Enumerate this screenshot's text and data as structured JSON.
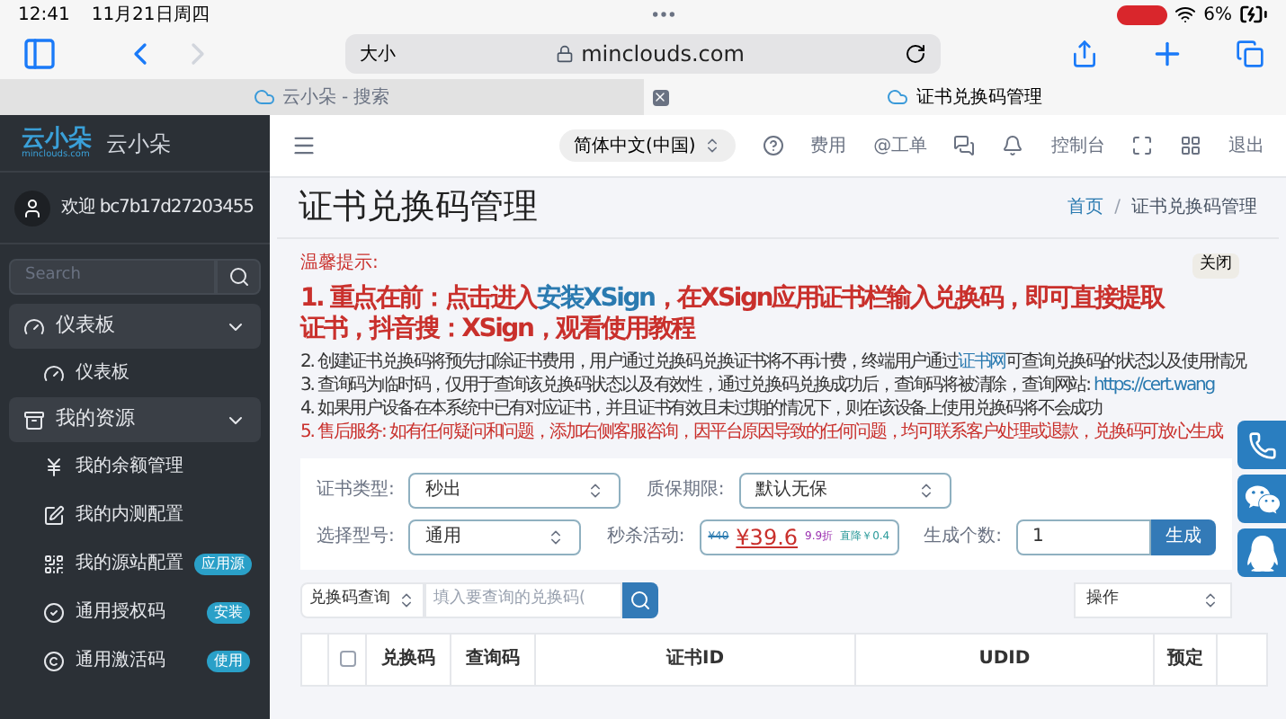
{
  "status_bar": {
    "time": "12:41",
    "date": "11月21日周四",
    "battery": "6%"
  },
  "browser": {
    "text_size": "大小",
    "url": "minclouds.com",
    "tabs": [
      {
        "title": "云小朵 - 搜索",
        "selected": false
      },
      {
        "title": "证书兑换码管理",
        "selected": true
      }
    ]
  },
  "sidebar": {
    "logo": "云小朵",
    "logo_sub": "minclouds.com",
    "brand": "云小朵",
    "welcome": "欢迎",
    "user_id": "bc7b17d27203455",
    "search": {
      "placeholder": "Search"
    },
    "menu": [
      {
        "label": "仪表板",
        "expanded": true,
        "children": [
          {
            "label": "仪表板"
          }
        ]
      },
      {
        "label": "我的资源",
        "expanded": true,
        "children": [
          {
            "label": "我的余额管理"
          },
          {
            "label": "我的内测配置"
          },
          {
            "label": "我的源站配置",
            "badge": "应用源"
          },
          {
            "label": "通用授权码",
            "badge": "安装"
          },
          {
            "label": "通用激活码",
            "badge": "使用"
          }
        ]
      }
    ]
  },
  "topbar": {
    "language": "简体中文(中国)",
    "items": [
      {
        "kind": "icon"
      },
      {
        "kind": "text",
        "label": "费用"
      },
      {
        "kind": "text",
        "label": "@工单"
      },
      {
        "kind": "icon"
      },
      {
        "kind": "icon"
      },
      {
        "kind": "text",
        "label": "控制台"
      },
      {
        "kind": "icon"
      },
      {
        "kind": "icon"
      },
      {
        "kind": "text",
        "label": "退出"
      }
    ]
  },
  "page": {
    "title": "证书兑换码管理",
    "breadcrumb": {
      "home": "首页",
      "separator": "/",
      "current": "证书兑换码管理"
    }
  },
  "notice": {
    "heading": "温馨提示:",
    "close": "关闭",
    "lines": [
      {
        "kind": "major",
        "before": "1. 重点在前：点击进入",
        "link": "安装XSign",
        "after": "，在XSign应用证书栏输入兑换码，即可直接提取证书，抖音搜：XSign，观看使用教程"
      },
      {
        "kind": "normal",
        "before": "2. 创建证书兑换码将预先扣除证书费用，用户通过兑换码兑换证书将不再计费，终端用户通过",
        "link": "证书网",
        "after": "可查询兑换码的状态以及使用情况"
      },
      {
        "kind": "normal",
        "before": "3. 查询码为临时码，仅用于查询该兑换码状态以及有效性，通过兑换码兑换成功后，查询码将被清除，查询网站: ",
        "link": "https://cert.wang"
      },
      {
        "kind": "normal",
        "before": "4. 如果用户设备在本系统中已有对应证书，并且证书有效且未过期的情况下，则在该设备上使用兑换码将不会成功"
      },
      {
        "kind": "warning",
        "before": "5. 售后服务: 如有任何疑问和问题，添加右侧客服咨询，因平台原因导致的任何问题，均可联系客户处理或退款，兑换码可放心生成"
      }
    ]
  },
  "form": {
    "cert_type": {
      "label": "证书类型:",
      "value": "秒出"
    },
    "warranty": {
      "label": "质保期限:",
      "value": "默认无保"
    },
    "model": {
      "label": "选择型号:",
      "value": "通用"
    },
    "flash_sale": {
      "label": "秒杀活动:",
      "original_price": "¥40",
      "price": "¥39.6",
      "discount": "9.9折",
      "saving": "直降￥0.4"
    },
    "count": {
      "label": "生成个数:",
      "value": "1",
      "button": "生成"
    }
  },
  "query": {
    "type": "兑换码查询",
    "placeholder": "填入要查询的兑换码(",
    "action": "操作"
  },
  "table": {
    "select_all_checked": false,
    "columns": [
      "兑换码",
      "查询码",
      "证书ID",
      "UDID",
      "预定"
    ]
  }
}
